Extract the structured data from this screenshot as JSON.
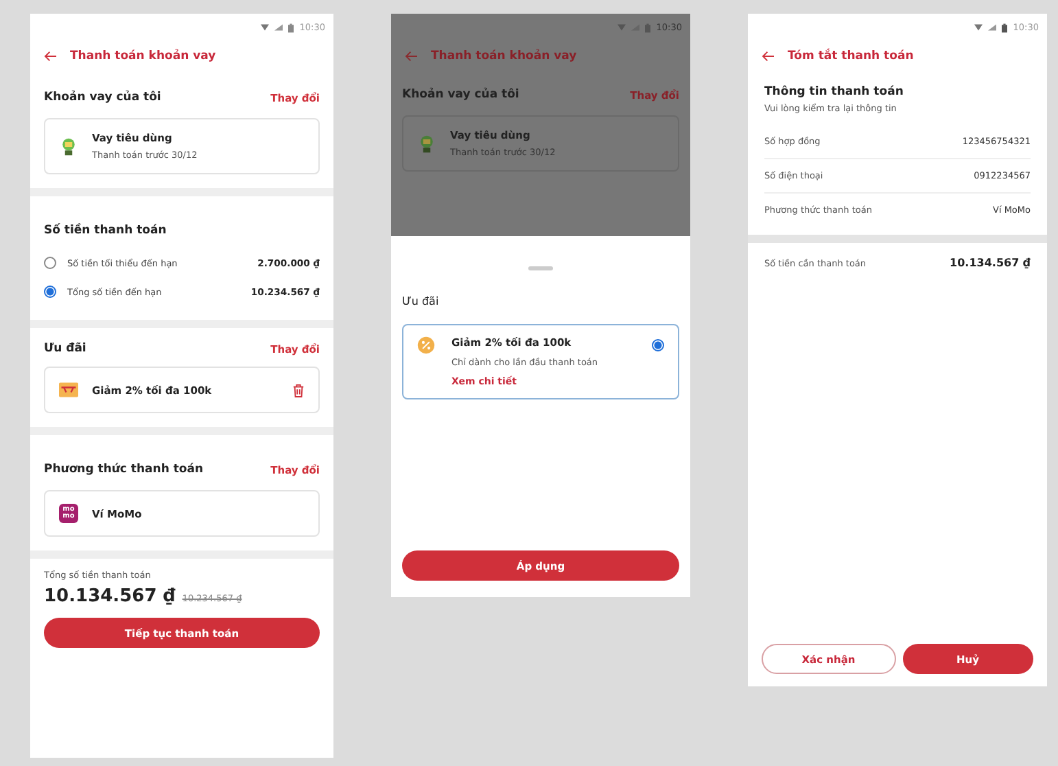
{
  "payment_screen": {
    "status_time": "10:30",
    "title": "Thanh toán khoản vay",
    "loan_section": {
      "heading": "Khoản vay của tôi",
      "action": "Thay đổi",
      "loan_name": "Vay tiêu dùng",
      "loan_due": "Thanh toán trước 30/12"
    },
    "amount_section": {
      "heading": "Số tiền thanh toán",
      "options": [
        {
          "label": "Số tiền tối thiểu đến hạn",
          "amount": "2.700.000 ₫",
          "selected": false
        },
        {
          "label": "Tổng số tiền đến hạn",
          "amount": "10.234.567 ₫",
          "selected": true
        }
      ]
    },
    "offer_section": {
      "heading": "Ưu đãi",
      "action": "Thay đổi",
      "offer": "Giảm 2% tối đa 100k"
    },
    "method_section": {
      "heading": "Phương thức thanh toán",
      "action": "Thay đổi",
      "logo_lines": [
        "mo",
        "mo"
      ],
      "method": "Ví MoMo"
    },
    "footer": {
      "total_label": "Tổng số tiền thanh toán",
      "total": "10.134.567 ₫",
      "original": "10.234.567 ₫",
      "button": "Tiếp tục thanh toán"
    }
  },
  "offer_sheet_screen": {
    "status_time": "10:30",
    "title": "Thanh toán khoản vay",
    "loan_heading": "Khoản vay của tôi",
    "loan_action": "Thay đổi",
    "loan_name": "Vay tiêu dùng",
    "loan_due": "Thanh toán trước 30/12",
    "sheet": {
      "heading": "Ưu đãi",
      "offers": [
        {
          "title": "Giảm 2% tối đa 100k",
          "note": "Chỉ dành cho lần đầu thanh toán",
          "link": "Xem chi tiết",
          "selected": true
        }
      ],
      "button": "Áp dụng"
    }
  },
  "summary_screen": {
    "status_time": "10:30",
    "title": "Tóm tắt thanh toán",
    "heading": "Thông tin thanh toán",
    "subheading": "Vui lòng kiểm tra lại thông tin",
    "rows": [
      {
        "label": "Số hợp đồng",
        "value": "123456754321"
      },
      {
        "label": "Số điện thoại",
        "value": "0912234567"
      },
      {
        "label": "Phương thức thanh toán",
        "value": "Ví MoMo"
      }
    ],
    "amount_label": "Số tiền cần thanh toán",
    "amount": "10.134.567 ₫",
    "buttons": [
      {
        "label": "Xác nhận",
        "kind": "outline"
      },
      {
        "label": "Huỷ",
        "kind": "filled"
      }
    ]
  }
}
